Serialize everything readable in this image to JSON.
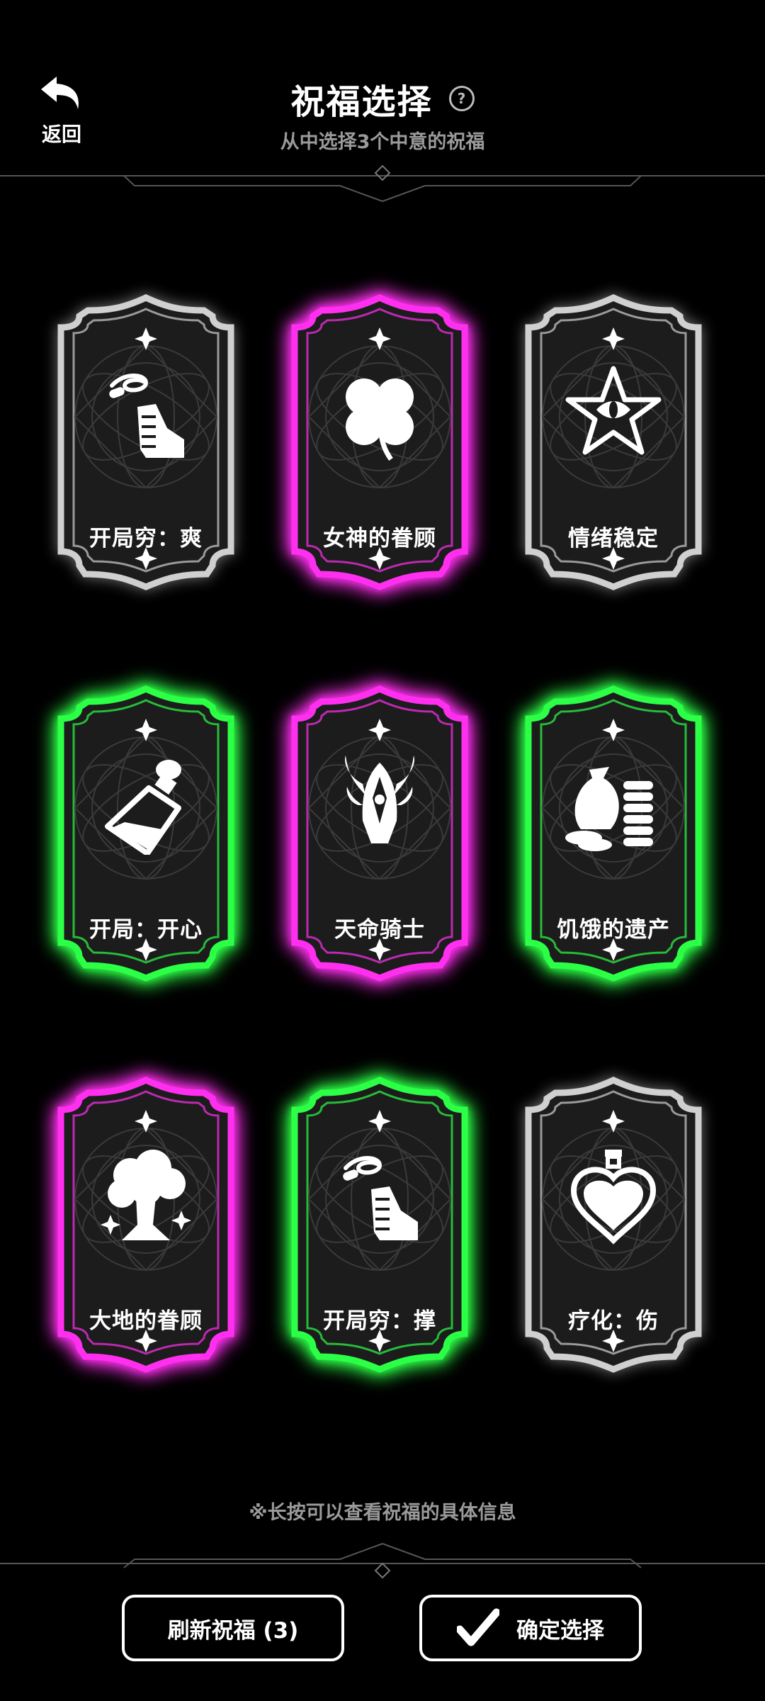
{
  "header": {
    "back_label": "返回",
    "title": "祝福选择",
    "help_glyph": "?",
    "subtitle": "从中选择3个中意的祝福"
  },
  "cards": [
    {
      "name": "开局穷：爽",
      "rarity": "common",
      "icon": "hand-rope-icon"
    },
    {
      "name": "女神的眷顾",
      "rarity": "epic",
      "icon": "clover-icon"
    },
    {
      "name": "情绪稳定",
      "rarity": "common",
      "icon": "star-eye-icon"
    },
    {
      "name": "开局：开心",
      "rarity": "rare",
      "icon": "potion-bottle-icon"
    },
    {
      "name": "天命骑士",
      "rarity": "epic",
      "icon": "winged-helmet-icon"
    },
    {
      "name": "饥饿的遗产",
      "rarity": "rare",
      "icon": "money-bag-coins-icon"
    },
    {
      "name": "大地的眷顾",
      "rarity": "epic",
      "icon": "sparkling-tree-icon"
    },
    {
      "name": "开局穷：撑",
      "rarity": "rare",
      "icon": "hand-rope-icon"
    },
    {
      "name": "疗化：伤",
      "rarity": "common",
      "icon": "heart-potion-icon"
    }
  ],
  "rarity_colors": {
    "common": "#d0d0d0",
    "rare": "#2bff46",
    "epic": "#ff2ff0"
  },
  "hint": "※长按可以查看祝福的具体信息",
  "buttons": {
    "refresh_label": "刷新祝福 (3)",
    "confirm_label": "确定选择"
  }
}
